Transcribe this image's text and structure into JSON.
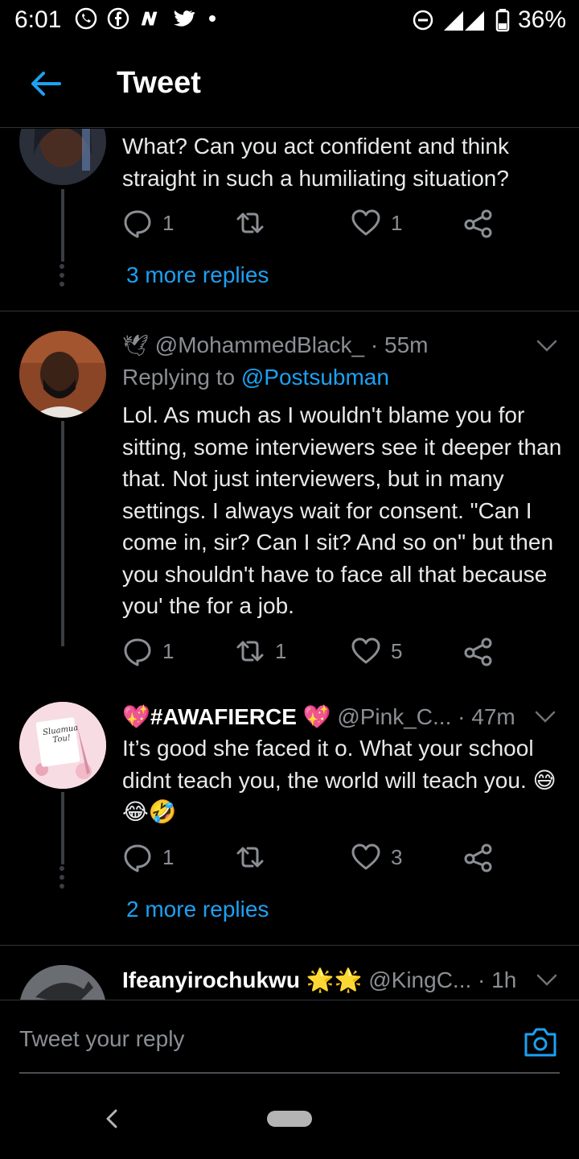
{
  "status_bar": {
    "time": "6:01",
    "network": "3G",
    "battery": "36%",
    "icons": [
      "whatsapp-icon",
      "facebook-icon",
      "news-icon",
      "twitter-icon",
      "dnd-icon",
      "signal-icon",
      "battery-icon"
    ]
  },
  "header": {
    "title": "Tweet",
    "accent": "#1da1f2"
  },
  "tweets": [
    {
      "text": "What? Can you act confident and think straight in such a humiliating situation?",
      "replies": "1",
      "retweets": "",
      "likes": "1",
      "more_replies": "3 more replies"
    },
    {
      "display_name": "",
      "name_emoji": "🕊",
      "handle": "@MohammedBlack_",
      "time": "· 55m",
      "replying_prefix": "Replying to ",
      "replying_to": "@Postsubman",
      "text": "Lol. As much as I wouldn't blame you for sitting, some interviewers see it deeper than that. Not just interviewers, but in many settings. I always wait for consent. \"Can I come in, sir? Can I sit? And so on\" but then you shouldn't have to face all that because you' the for a job.",
      "replies": "1",
      "retweets": "1",
      "likes": "5"
    },
    {
      "display_name": "💖#AWAFIERCE 💖",
      "handle": "@Pink_C...",
      "time": "· 47m",
      "avatar_text": "Sluamua Tou!",
      "text": "It’s good she faced it o. What your school didnt teach you, the world will teach you. 😅😂🤣",
      "replies": "1",
      "retweets": "",
      "likes": "3",
      "more_replies": "2 more replies"
    },
    {
      "display_name": "Ifeanyirochukwu 🌟🌟",
      "handle": "@KingC...",
      "time": "· 1h"
    }
  ],
  "reply_bar": {
    "placeholder": "Tweet your reply"
  }
}
